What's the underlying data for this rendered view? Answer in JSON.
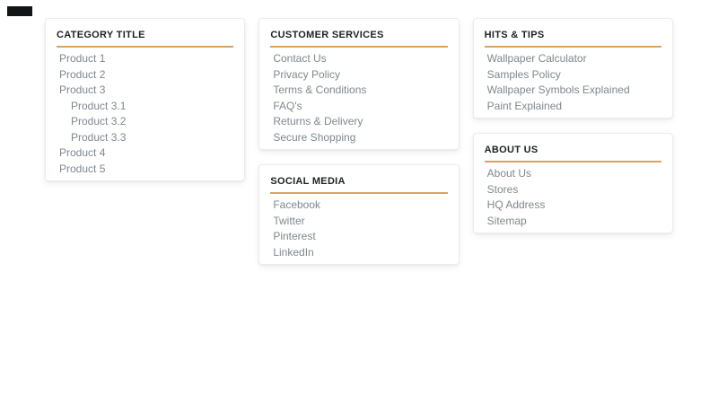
{
  "page": {
    "background_color": "#ffffff",
    "accent_underline_color": "#d8a463",
    "panel_title_color": "#1c2125",
    "link_color": "#7f888f",
    "top_left_bar_color": "#111518"
  },
  "panels": {
    "category": {
      "title": "CATEGORY TITLE",
      "items": [
        {
          "label": "Product 1",
          "level": 0
        },
        {
          "label": "Product 2",
          "level": 0
        },
        {
          "label": "Product 3",
          "level": 0
        },
        {
          "label": "Product 3.1",
          "level": 1
        },
        {
          "label": "Product 3.2",
          "level": 1
        },
        {
          "label": "Product 3.3",
          "level": 1
        },
        {
          "label": "Product 4",
          "level": 0
        },
        {
          "label": "Product 5",
          "level": 0
        }
      ]
    },
    "customer_services": {
      "title": "CUSTOMER SERVICES",
      "items": [
        "Contact Us",
        "Privacy Policy",
        "Terms & Conditions",
        "FAQ's",
        "Returns & Delivery",
        "Secure Shopping"
      ]
    },
    "social_media": {
      "title": "SOCIAL MEDIA",
      "items": [
        "Facebook",
        "Twitter",
        "Pinterest",
        "LinkedIn"
      ]
    },
    "hits_tips": {
      "title": "HITS & TIPS",
      "items": [
        "Wallpaper Calculator",
        "Samples Policy",
        "Wallpaper Symbols Explained",
        "Paint Explained"
      ]
    },
    "about_us": {
      "title": "ABOUT US",
      "items": [
        "About Us",
        "Stores",
        "HQ Address",
        "Sitemap"
      ]
    }
  }
}
